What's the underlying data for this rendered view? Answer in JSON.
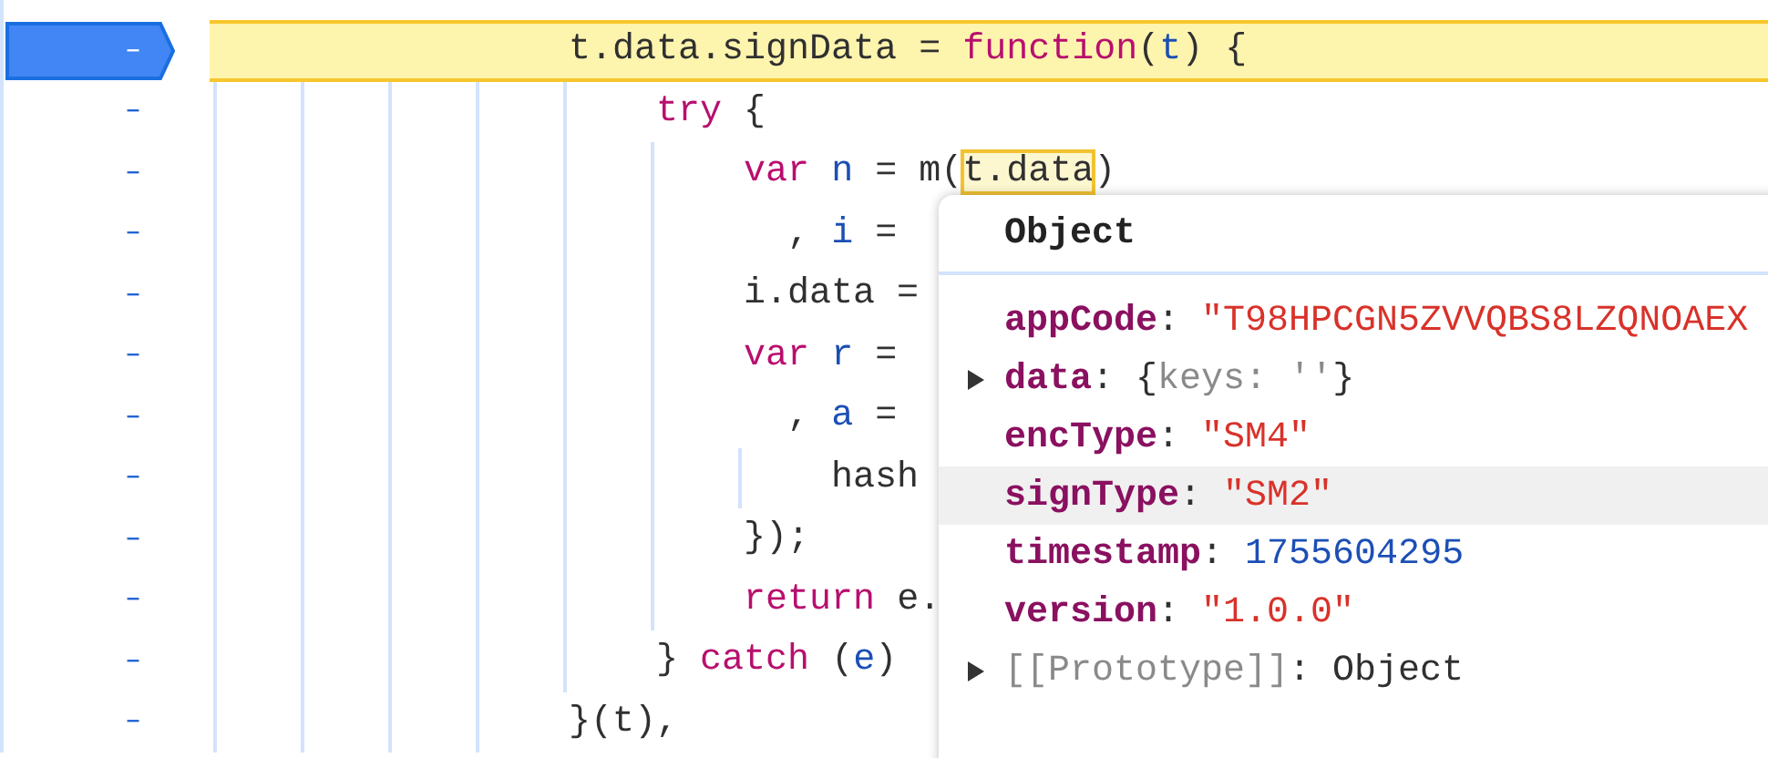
{
  "code_lines": [
    {
      "marker": "–",
      "breakpoint": true,
      "paused": true,
      "tokens": [
        {
          "t": "                t.data.signData = ",
          "kind": "plain"
        },
        {
          "t": "function",
          "kind": "keyword"
        },
        {
          "t": "(",
          "kind": "plain"
        },
        {
          "t": "t",
          "kind": "variable"
        },
        {
          "t": ") {",
          "kind": "plain"
        }
      ]
    },
    {
      "marker": "–",
      "breakpoint": false,
      "paused": false,
      "tokens": [
        {
          "t": "                    try",
          "kind": "keyword"
        },
        {
          "t": " {",
          "kind": "plain"
        }
      ]
    },
    {
      "marker": "–",
      "breakpoint": false,
      "paused": false,
      "tokens": [
        {
          "t": "                        var",
          "kind": "keyword"
        },
        {
          "t": " n",
          "kind": "variable"
        },
        {
          "t": " = m(",
          "kind": "plain"
        },
        {
          "t": "t.data",
          "kind": "plain",
          "hovered": true
        },
        {
          "t": ")",
          "kind": "plain"
        }
      ]
    },
    {
      "marker": "–",
      "breakpoint": false,
      "paused": false,
      "tokens": [
        {
          "t": "                          , ",
          "kind": "plain"
        },
        {
          "t": "i",
          "kind": "variable"
        },
        {
          "t": " =",
          "kind": "plain"
        }
      ]
    },
    {
      "marker": "–",
      "breakpoint": false,
      "paused": false,
      "tokens": [
        {
          "t": "                        i.data =",
          "kind": "plain"
        }
      ]
    },
    {
      "marker": "–",
      "breakpoint": false,
      "paused": false,
      "tokens": [
        {
          "t": "                        var",
          "kind": "keyword"
        },
        {
          "t": " r",
          "kind": "variable"
        },
        {
          "t": " =",
          "kind": "plain"
        }
      ]
    },
    {
      "marker": "–",
      "breakpoint": false,
      "paused": false,
      "tokens": [
        {
          "t": "                          , ",
          "kind": "plain"
        },
        {
          "t": "a",
          "kind": "variable"
        },
        {
          "t": " =",
          "kind": "plain"
        }
      ]
    },
    {
      "marker": "–",
      "breakpoint": false,
      "paused": false,
      "tokens": [
        {
          "t": "                            hash",
          "kind": "plain"
        }
      ]
    },
    {
      "marker": "–",
      "breakpoint": false,
      "paused": false,
      "tokens": [
        {
          "t": "                        });",
          "kind": "plain"
        }
      ]
    },
    {
      "marker": "–",
      "breakpoint": false,
      "paused": false,
      "tokens": [
        {
          "t": "                        return",
          "kind": "keyword"
        },
        {
          "t": " e.",
          "kind": "plain"
        }
      ]
    },
    {
      "marker": "–",
      "breakpoint": false,
      "paused": false,
      "tokens": [
        {
          "t": "                    } ",
          "kind": "plain"
        },
        {
          "t": "catch",
          "kind": "keyword"
        },
        {
          "t": " (",
          "kind": "plain"
        },
        {
          "t": "e",
          "kind": "variable"
        },
        {
          "t": ")",
          "kind": "plain"
        }
      ]
    },
    {
      "marker": "–",
      "breakpoint": false,
      "paused": false,
      "tokens": [
        {
          "t": "                }(t),",
          "kind": "plain"
        }
      ]
    }
  ],
  "popover": {
    "title": "Object",
    "rows": [
      {
        "kind": "property",
        "key": "appCode",
        "separator": ":",
        "expandable": false,
        "hovered": false,
        "value": [
          {
            "t": "\"T98HPCGN5ZVVQBS8LZQNOAEX",
            "kind": "string"
          }
        ]
      },
      {
        "kind": "property",
        "key": "data",
        "separator": ":",
        "expandable": true,
        "hovered": false,
        "value": [
          {
            "t": "{",
            "kind": "plain"
          },
          {
            "t": "keys:",
            "kind": "muted"
          },
          {
            "t": "''",
            "kind": "muted"
          },
          {
            "t": "}",
            "kind": "plain"
          }
        ]
      },
      {
        "kind": "property",
        "key": "encType",
        "separator": ":",
        "expandable": false,
        "hovered": false,
        "value": [
          {
            "t": "\"SM4\"",
            "kind": "string"
          }
        ]
      },
      {
        "kind": "property",
        "key": "signType",
        "separator": ":",
        "expandable": false,
        "hovered": true,
        "value": [
          {
            "t": "\"SM2\"",
            "kind": "string"
          }
        ]
      },
      {
        "kind": "property",
        "key": "timestamp",
        "separator": ":",
        "expandable": false,
        "hovered": false,
        "value": [
          {
            "t": "1755604295",
            "kind": "number"
          }
        ]
      },
      {
        "kind": "property",
        "key": "version",
        "separator": ":",
        "expandable": false,
        "hovered": false,
        "value": [
          {
            "t": "\"1.0.0\"",
            "kind": "string"
          }
        ]
      },
      {
        "kind": "internal",
        "key": "[[Prototype]]",
        "separator": ":",
        "expandable": true,
        "hovered": false,
        "value": [
          {
            "t": "Object",
            "kind": "plain"
          }
        ]
      }
    ]
  }
}
